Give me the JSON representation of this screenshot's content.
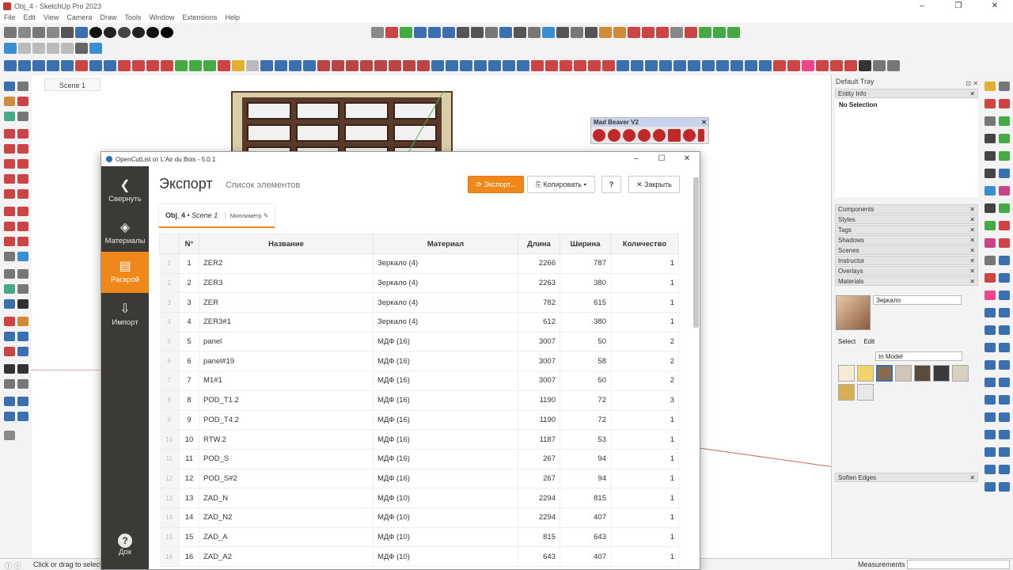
{
  "app": {
    "title": "Obj_4 - SketchUp Pro 2023",
    "menu": [
      "File",
      "Edit",
      "View",
      "Camera",
      "Draw",
      "Tools",
      "Window",
      "Extensions",
      "Help"
    ],
    "win_ctrls": [
      "–",
      "❐",
      "✕"
    ]
  },
  "viewport": {
    "scene_tab": "Scene 1"
  },
  "mad_beaver": {
    "title": "Mad Beaver V2",
    "close": "✕"
  },
  "tray": {
    "title": "Default Tray",
    "entity_info": "Entity Info",
    "no_selection": "No Selection",
    "sections": [
      "Components",
      "Styles",
      "Tags",
      "Shadows",
      "Scenes",
      "Instructor",
      "Overlays",
      "Materials"
    ],
    "soft_edges": "Soften Edges",
    "material_name": "Зеркало",
    "tab_select": "Select",
    "tab_edit": "Edit",
    "in_model": "In Model"
  },
  "status": {
    "hint": "Click or drag to select objects. Shift = Add/Subtract. Ctrl = Add. Shift + Ctrl = Subtract.",
    "measurements": "Measurements",
    "icons": "ⓘ  ⓘ"
  },
  "ocl": {
    "title": "OpenCutList от L'Air du Bois - 5.0.1",
    "ctrls": [
      "–",
      "☐",
      "✕"
    ],
    "sidebar": {
      "collapse": "Свернуть",
      "materials": "Материалы",
      "cutlist": "Раскрой",
      "import": "Импорт",
      "doc": "Док"
    },
    "heading": "Экспорт",
    "subheading": "Список элементов",
    "btn_export": "⟳ Экспорт...",
    "btn_copy": "⎘ Копировать ▾",
    "btn_help": "?",
    "btn_close": "✕ Закрыть",
    "doc_model": "Obj_4",
    "doc_scene": "Scene 1",
    "doc_unit": "Миллиметр ✎",
    "columns": [
      "N°",
      "Название",
      "Материал",
      "Длина",
      "Ширина",
      "Количество"
    ],
    "rows": [
      {
        "idx": "1",
        "num": "1",
        "name": "ZER2",
        "mat": "Зеркало (4)",
        "len": "2266",
        "wid": "787",
        "qty": "1"
      },
      {
        "idx": "2",
        "num": "2",
        "name": "ZER3",
        "mat": "Зеркало (4)",
        "len": "2263",
        "wid": "380",
        "qty": "1"
      },
      {
        "idx": "3",
        "num": "3",
        "name": "ZER",
        "mat": "Зеркало (4)",
        "len": "782",
        "wid": "615",
        "qty": "1"
      },
      {
        "idx": "4",
        "num": "4",
        "name": "ZER3#1",
        "mat": "Зеркало (4)",
        "len": "612",
        "wid": "380",
        "qty": "1"
      },
      {
        "idx": "5",
        "num": "5",
        "name": "panel",
        "mat": "МДФ (16)",
        "len": "3007",
        "wid": "50",
        "qty": "2"
      },
      {
        "idx": "6",
        "num": "6",
        "name": "panel#19",
        "mat": "МДФ (16)",
        "len": "3007",
        "wid": "58",
        "qty": "2"
      },
      {
        "idx": "7",
        "num": "7",
        "name": "M1#1",
        "mat": "МДФ (16)",
        "len": "3007",
        "wid": "50",
        "qty": "2"
      },
      {
        "idx": "8",
        "num": "8",
        "name": "POD_T1.2",
        "mat": "МДФ (16)",
        "len": "1190",
        "wid": "72",
        "qty": "3"
      },
      {
        "idx": "9",
        "num": "9",
        "name": "POD_T4.2",
        "mat": "МДФ (16)",
        "len": "1190",
        "wid": "72",
        "qty": "1"
      },
      {
        "idx": "10",
        "num": "10",
        "name": "RTW.2",
        "mat": "МДФ (16)",
        "len": "1187",
        "wid": "53",
        "qty": "1"
      },
      {
        "idx": "11",
        "num": "11",
        "name": "POD_S",
        "mat": "МДФ (16)",
        "len": "267",
        "wid": "94",
        "qty": "1"
      },
      {
        "idx": "12",
        "num": "12",
        "name": "POD_S#2",
        "mat": "МДФ (16)",
        "len": "267",
        "wid": "94",
        "qty": "1"
      },
      {
        "idx": "13",
        "num": "13",
        "name": "ZAD_N",
        "mat": "МДФ (10)",
        "len": "2294",
        "wid": "815",
        "qty": "1"
      },
      {
        "idx": "14",
        "num": "14",
        "name": "ZAD_N2",
        "mat": "МДФ (10)",
        "len": "2294",
        "wid": "407",
        "qty": "1"
      },
      {
        "idx": "15",
        "num": "15",
        "name": "ZAD_A",
        "mat": "МДФ (10)",
        "len": "815",
        "wid": "643",
        "qty": "1"
      },
      {
        "idx": "16",
        "num": "16",
        "name": "ZAD_A2",
        "mat": "МДФ (10)",
        "len": "643",
        "wid": "407",
        "qty": "1"
      }
    ]
  },
  "colors": {
    "accent": "#f0871a",
    "sidebar": "#3b3a36"
  }
}
